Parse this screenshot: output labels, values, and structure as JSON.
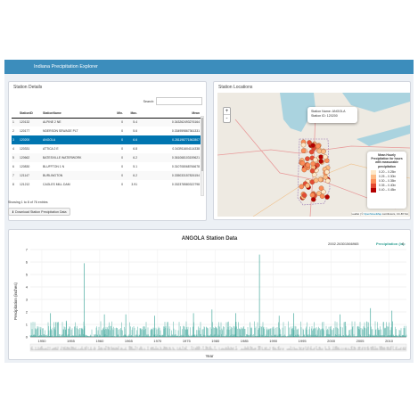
{
  "app_title": "Indiana Precipitation Explorer",
  "station_details": {
    "title": "Station Details",
    "search_label": "Search:",
    "columns": [
      "",
      "StationID",
      "StationName",
      "Min.",
      "Max.",
      "Mean"
    ],
    "rows": [
      {
        "idx": "1",
        "id": "120132",
        "name": "ALPINE 2 NE",
        "min": "0",
        "max": "5.4",
        "mean": "0.343262493276164",
        "selected": false
      },
      {
        "idx": "2",
        "id": "120177",
        "name": "NDERSON SEWAGE PLT",
        "min": "0",
        "max": "5.6",
        "mean": "0.334959867361331",
        "selected": false
      },
      {
        "idx": "3",
        "id": "120200",
        "name": "ANGOLA",
        "min": "0",
        "max": "6.6",
        "mean": "0.281198771562807",
        "selected": true
      },
      {
        "idx": "4",
        "id": "120331",
        "name": "ATTICA 2 E",
        "min": "0",
        "max": "6.8",
        "mean": "0.343911604114338",
        "selected": false
      },
      {
        "idx": "5",
        "id": "120662",
        "name": "BATESVILLE WATERWORK",
        "min": "0",
        "max": "6.2",
        "mean": "0.361068103159621",
        "selected": false
      },
      {
        "idx": "6",
        "id": "120830",
        "name": "BLUFFTON 1 N",
        "min": "0",
        "max": "5.1",
        "mean": "0.310708068766678",
        "selected": false
      },
      {
        "idx": "7",
        "id": "121147",
        "name": "BURLINGTON",
        "min": "0",
        "max": "6.2",
        "mean": "0.335033157826154",
        "selected": false
      },
      {
        "idx": "8",
        "id": "121212",
        "name": "CAGLES MILL DAM",
        "min": "0",
        "max": "3.91",
        "mean": "0.332378580322798",
        "selected": false
      }
    ],
    "info": "Showing 1 to 8 of 76 entries",
    "download_label": "Download Station Precipitation Data"
  },
  "station_locations": {
    "title": "Station Locations",
    "zoom_in": "+",
    "zoom_out": "-",
    "popup_line1": "Station Name: ANGOLA",
    "popup_line2": "Station ID: 120200",
    "legend_title": "Mean Hourly Precipitation for hours with measurable precipitation",
    "legend_items": [
      {
        "label": "0.20 – 0.25in",
        "color": "#fee8c8"
      },
      {
        "label": "0.25 – 0.30in",
        "color": "#fdbb84"
      },
      {
        "label": "0.30 – 0.35in",
        "color": "#fc8d59"
      },
      {
        "label": "0.35 – 0.40in",
        "color": "#e34a33"
      },
      {
        "label": "0.40 – 0.45in",
        "color": "#b30000"
      }
    ],
    "attribution_prefix": "Leaflet | © ",
    "attribution_link": "OpenStreetMap",
    "attribution_suffix": " contributors, CC-BY-SA"
  },
  "chart_title": "ANGOLA Station Data",
  "chart_readout": "2002.26301566965",
  "chart_readout_series": "Precipitation (in):",
  "chart_readout_value": "0",
  "chart_data": {
    "type": "line",
    "title": "ANGOLA Station Data",
    "xlabel": "Year",
    "ylabel": "Precipitation (inches)",
    "xlim": [
      1948,
      2013
    ],
    "ylim": [
      0,
      7
    ],
    "x_ticks": [
      "1950",
      "1955",
      "1960",
      "1965",
      "1970",
      "1975",
      "1980",
      "1985",
      "1990",
      "1995",
      "2000",
      "2005",
      "2010"
    ],
    "y_ticks": [
      "0",
      "1",
      "2",
      "3",
      "4",
      "5",
      "6",
      "7"
    ],
    "series": [
      {
        "name": "Precipitation (in)",
        "color": "#2a9d8f",
        "peaks": [
          [
            1951.5,
            1.9
          ],
          [
            1954.2,
            1.3
          ],
          [
            1957.3,
            5.9
          ],
          [
            1960.8,
            1.8
          ],
          [
            1964.5,
            1.8
          ],
          [
            1969.5,
            1.7
          ],
          [
            1976.2,
            1.9
          ],
          [
            1979.4,
            2.2
          ],
          [
            1983.5,
            1.9
          ],
          [
            1987.6,
            6.6
          ],
          [
            1991.0,
            1.7
          ],
          [
            1993.5,
            1.9
          ],
          [
            2001.5,
            1.8
          ],
          [
            2006.8,
            2.3
          ],
          [
            2010.5,
            2.1
          ]
        ]
      }
    ]
  }
}
